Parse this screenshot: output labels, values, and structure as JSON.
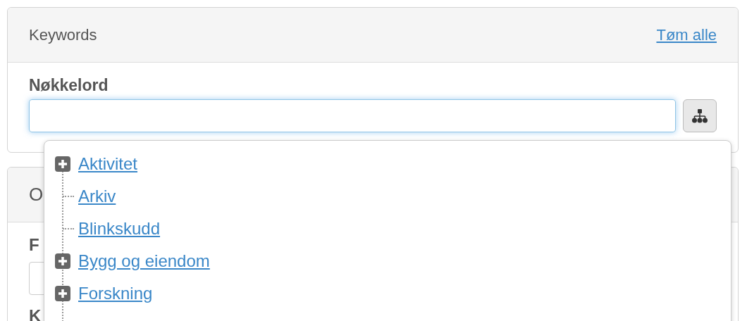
{
  "keywords_panel": {
    "title": "Keywords",
    "clear_link": "Tøm alle",
    "field_label": "Nøkkelord"
  },
  "second_panel": {
    "title": "O",
    "field_label": "F",
    "second_label": "K"
  },
  "tree_dropdown": {
    "items": [
      {
        "label": "Aktivitet",
        "kind": "branch"
      },
      {
        "label": "Arkiv",
        "kind": "leaf"
      },
      {
        "label": "Blinkskudd",
        "kind": "leaf"
      },
      {
        "label": "Bygg og eiendom",
        "kind": "branch"
      },
      {
        "label": "Forskning",
        "kind": "branch"
      }
    ]
  }
}
